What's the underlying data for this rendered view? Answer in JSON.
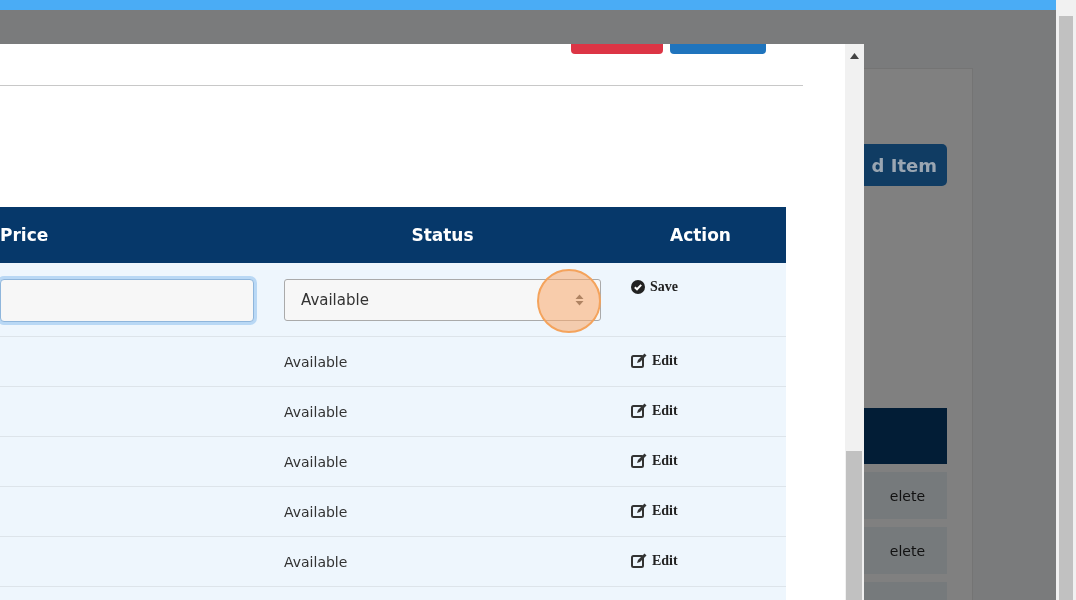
{
  "background_page": {
    "add_button": "d Item",
    "rows": [
      {
        "action": "elete"
      },
      {
        "action": "elete"
      }
    ]
  },
  "modal": {
    "columns": [
      "Price",
      "Status",
      "Action"
    ],
    "edit_row": {
      "status": "Available",
      "action": "Save"
    },
    "rows": [
      {
        "status": "Available",
        "action": "Edit"
      },
      {
        "status": "Available",
        "action": "Edit"
      },
      {
        "status": "Available",
        "action": "Edit"
      },
      {
        "status": "Available",
        "action": "Edit"
      },
      {
        "status": "Available",
        "action": "Edit"
      }
    ]
  }
}
